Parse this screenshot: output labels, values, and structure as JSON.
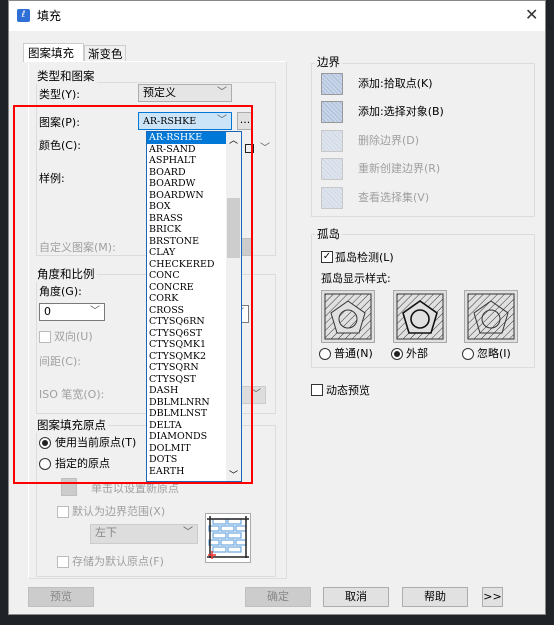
{
  "window": {
    "title": "填充",
    "close_icon": "close-icon",
    "app_icon": "hatch-icon"
  },
  "tabs": [
    {
      "label": "图案填充",
      "active": true
    },
    {
      "label": "渐变色",
      "active": false
    }
  ],
  "type_pattern": {
    "group_label": "类型和图案",
    "type_label": "类型(Y):",
    "type_value": "预定义",
    "pattern_label": "图案(P):",
    "pattern_value": "AR-RSHKE",
    "browse_label": "...",
    "color_label": "颜色(C):",
    "swatch_label": "样例:",
    "custom_label": "自定义图案(M):"
  },
  "pattern_options": [
    "AR-RSHKE",
    "AR-SAND",
    "ASPHALT",
    "BOARD",
    "BOARDW",
    "BOARDWN",
    "BOX",
    "BRASS",
    "BRICK",
    "BRSTONE",
    "CLAY",
    "CHECKERED",
    "CONC",
    "CONCRE",
    "CORK",
    "CROSS",
    "CTYSQ6RN",
    "CTYSQ6ST",
    "CTYSQMK1",
    "CTYSQMK2",
    "CTYSQRN",
    "CTYSQST",
    "DASH",
    "DBLMLNRN",
    "DBLMLNST",
    "DELTA",
    "DIAMONDS",
    "DOLMIT",
    "DOTS",
    "EARTH"
  ],
  "angle_scale": {
    "group_label": "角度和比例",
    "angle_label": "角度(G):",
    "angle_value": "0",
    "double_label": "双向(U)",
    "spacing_label": "间距(C):",
    "iso_label": "ISO 笔宽(O):",
    "paren_fragment": ")"
  },
  "origin": {
    "group_label": "图案填充原点",
    "use_current": "使用当前原点(T)",
    "specified": "指定的原点",
    "click_set": "单击以设置新原点",
    "default_extent": "默认为边界范围(X)",
    "position_value": "左下",
    "store_default": "存储为默认原点(F)"
  },
  "boundary": {
    "group_label": "边界",
    "items": [
      {
        "label": "添加:拾取点(K)",
        "enabled": true,
        "icon": "add-pick-point-icon"
      },
      {
        "label": "添加:选择对象(B)",
        "enabled": true,
        "icon": "add-select-object-icon"
      },
      {
        "label": "删除边界(D)",
        "enabled": false,
        "icon": "remove-boundary-icon"
      },
      {
        "label": "重新创建边界(R)",
        "enabled": false,
        "icon": "recreate-boundary-icon"
      },
      {
        "label": "查看选择集(V)",
        "enabled": false,
        "icon": "view-selection-icon"
      }
    ]
  },
  "island": {
    "group_label": "孤岛",
    "detect_label": "孤岛检测(L)",
    "detect_checked": true,
    "style_label": "孤岛显示样式:",
    "styles": [
      {
        "label": "普通(N)",
        "selected": false
      },
      {
        "label": "外部",
        "selected": true
      },
      {
        "label": "忽略(I)",
        "selected": false
      }
    ]
  },
  "dynamic_preview": {
    "label": "动态预览",
    "checked": false
  },
  "footer": {
    "preview": "预览",
    "ok": "确定",
    "cancel": "取消",
    "help": "帮助",
    "more": ">>"
  },
  "colors": {
    "highlight_border": "#ff0000",
    "selection": "#0078d7"
  }
}
